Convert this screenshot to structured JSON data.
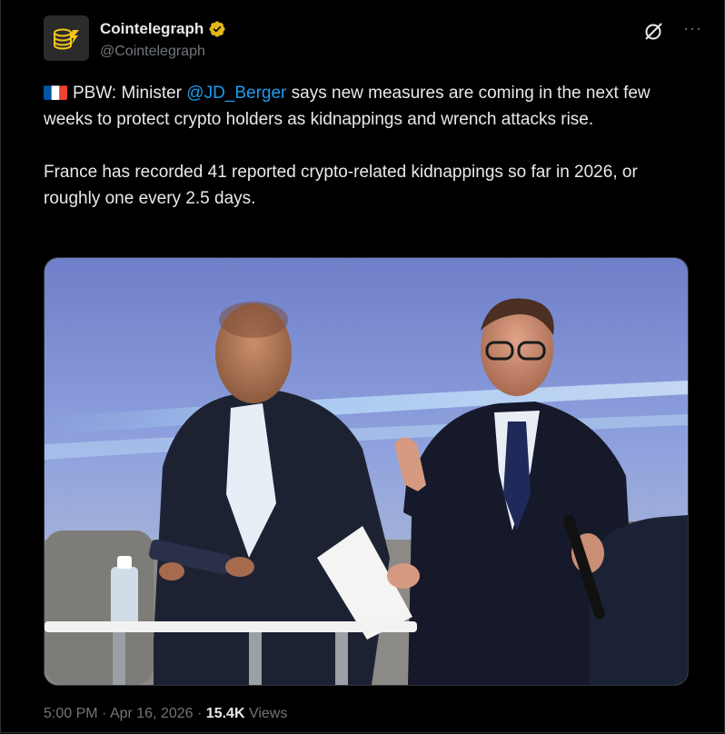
{
  "tweet": {
    "author": {
      "name": "Cointelegraph",
      "handle": "@Cointelegraph",
      "verified": true,
      "verified_color": "#e2b719",
      "avatar_icon": "cointelegraph-logo-icon"
    },
    "actions": {
      "grok_icon": "grok-icon",
      "more_label": "···"
    },
    "text": {
      "flag_icon": "france-flag-icon",
      "line1_prefix": "PBW: Minister ",
      "mention": "@JD_Berger",
      "line1_suffix": " says new measures are coming in the next few weeks to protect crypto holders as kidnappings and wrench attacks rise.",
      "paragraph2": "France has recorded 41 reported crypto-related kidnappings so far in 2026, or roughly one every 2.5 days."
    },
    "media": {
      "type": "photo",
      "icon": "photo-two-men-panel-discussion"
    },
    "footer": {
      "time": "5:00 PM",
      "separator": "·",
      "date": "Apr 16, 2026",
      "views_count": "15.4K",
      "views_label": "Views"
    },
    "colors": {
      "background": "#000000",
      "text": "#e7e9ea",
      "secondary": "#71767b",
      "link": "#1d9bf0"
    }
  }
}
